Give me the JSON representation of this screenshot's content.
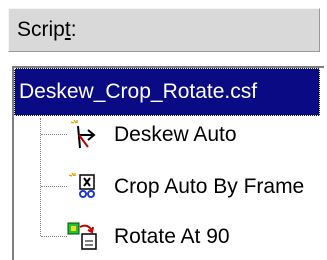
{
  "header": {
    "prefix": "Scrip",
    "accel": "t",
    "suffix": ":"
  },
  "tree": {
    "root": {
      "label": "Deskew_Crop_Rotate.csf"
    },
    "items": [
      {
        "label": "Deskew Auto",
        "icon": "deskew-icon"
      },
      {
        "label": "Crop Auto By Frame",
        "icon": "crop-icon"
      },
      {
        "label": "Rotate At 90",
        "icon": "rotate-icon"
      }
    ]
  },
  "colors": {
    "selection_bg": "#0a0a84",
    "selection_text": "#ffffff",
    "header_bg": "#d9d9d9"
  }
}
